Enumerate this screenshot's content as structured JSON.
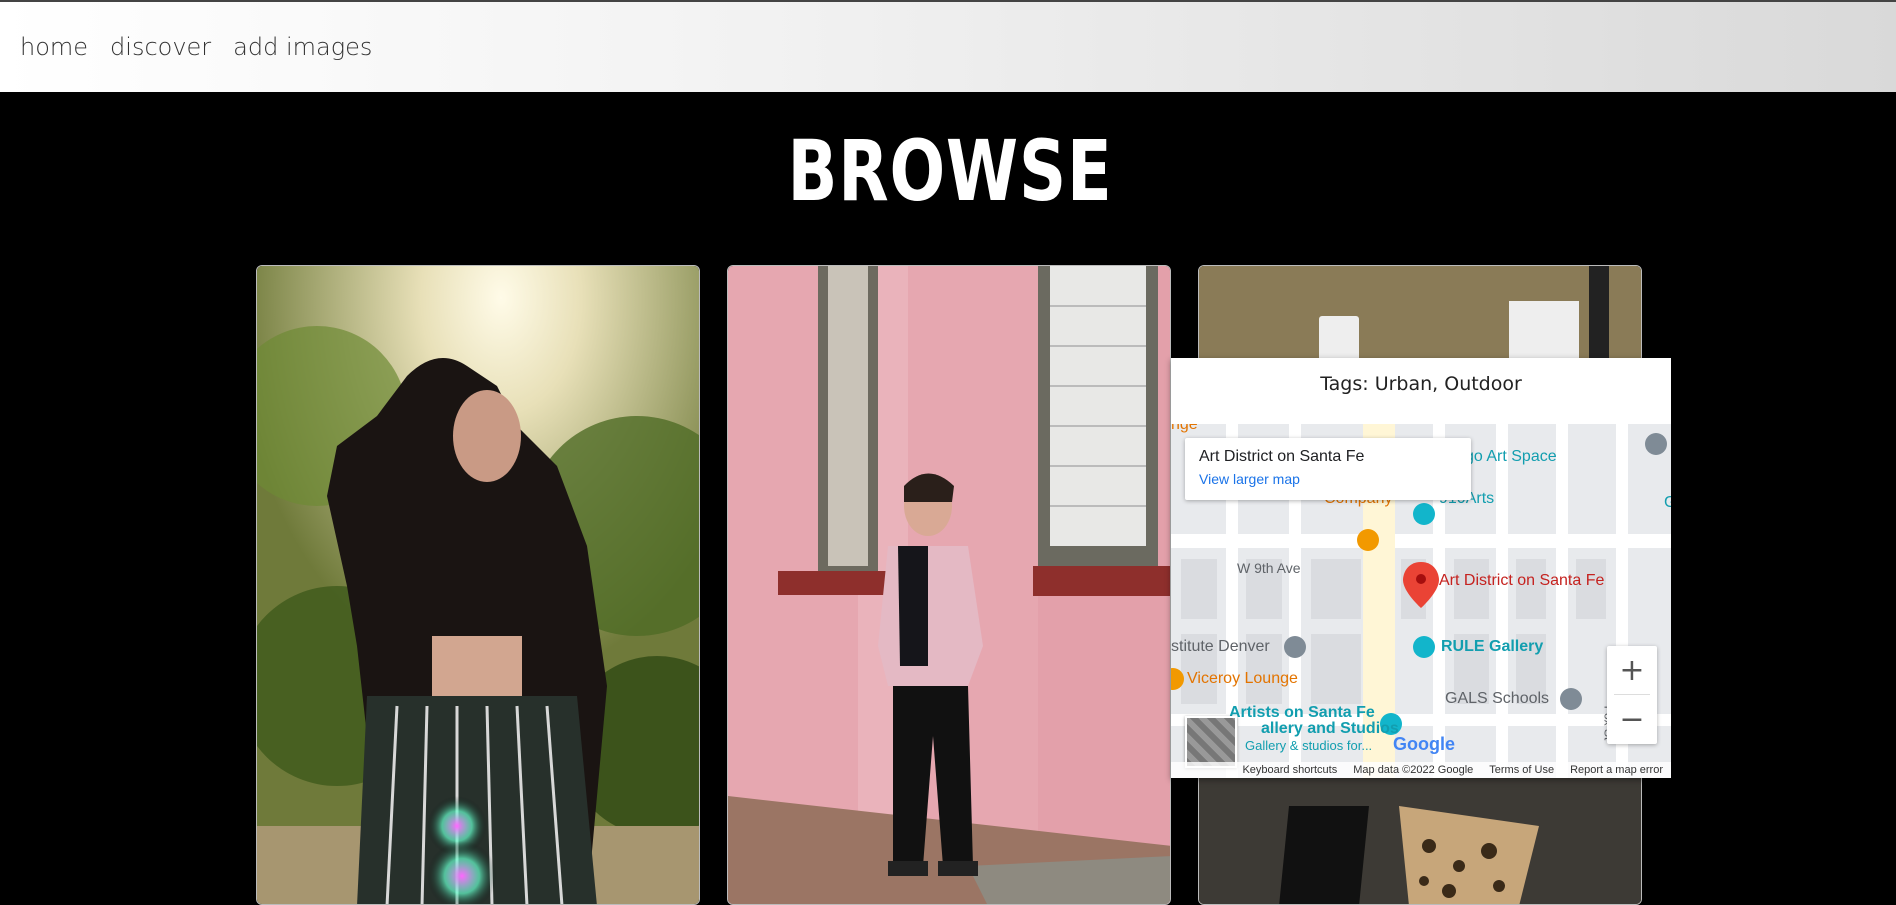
{
  "nav": {
    "home": "home",
    "discover": "discover",
    "add_images": "add images"
  },
  "page": {
    "title": "BROWSE"
  },
  "popup": {
    "tags": "Tags: Urban, Outdoor",
    "info_title": "Art District on Santa Fe",
    "info_link": "View larger map",
    "labels": {
      "go_art_space": "go Art Space",
      "company": "Company",
      "arts910": "910Arts",
      "w9th": "W 9th Ave",
      "art_district": "Art District on Santa Fe",
      "institute": "stitute Denver",
      "rule_gallery": "RULE Gallery",
      "viceroy": "Viceroy Lounge",
      "gals": "GALS Schools",
      "artists1": "Artists on Santa Fe",
      "artists2": "allery and Studios",
      "gallery_studios": "Gallery & studios for...",
      "fox_st": "Fox St",
      "nge": "nge",
      "g": "G",
      "google": "Google"
    },
    "attribution": {
      "shortcuts": "Keyboard shortcuts",
      "map_data": "Map data ©2022 Google",
      "terms": "Terms of Use",
      "report": "Report a map error"
    },
    "zoom_in": "+",
    "zoom_out": "−"
  }
}
